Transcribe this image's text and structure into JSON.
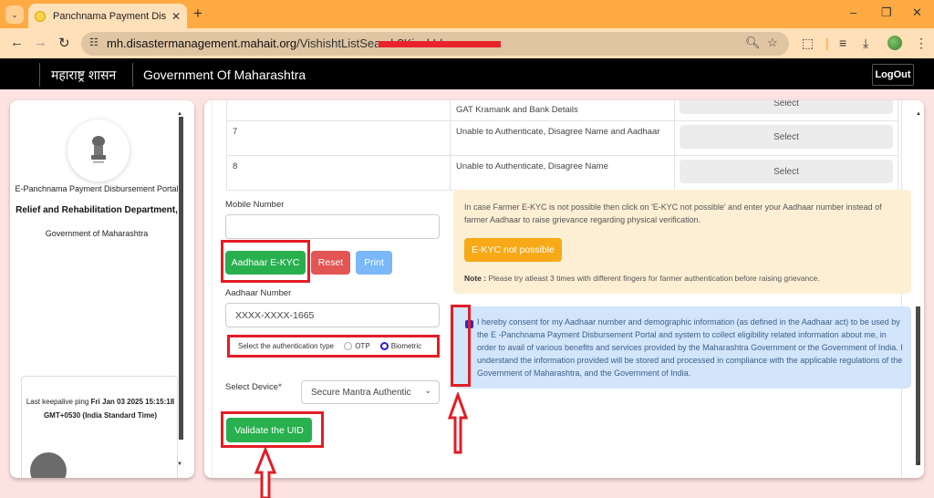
{
  "browser": {
    "tab_title": "Panchnama Payment Disbursement Portal",
    "tab_title_visible": "Panchnama Payment Disbursem",
    "url_domain": "mh.disastermanagement.mahait.org",
    "url_path": "/VishishtListSearch?KioskId=",
    "icons": {
      "tab_search": "chevron-down-icon",
      "close_tab": "close-icon",
      "new_tab": "plus-icon",
      "minimize": "minimize-icon",
      "restore": "restore-icon",
      "close_window": "close-icon",
      "back": "back-arrow-icon",
      "forward": "forward-arrow-icon",
      "reload": "reload-icon",
      "site_info": "tune-icon",
      "zoom": "zoom-icon",
      "bookmark": "star-icon",
      "extensions": "puzzle-icon",
      "media": "media-queue-icon",
      "downloads": "download-icon",
      "menu": "kebab-menu-icon"
    }
  },
  "header": {
    "marathi_title": "महाराष्ट्र शासन",
    "gov_title": "Government Of Maharashtra",
    "logout_label": "LogOut"
  },
  "sidebar": {
    "portal_name": "E-Panchnama Payment Disbursement Portal",
    "department": "Relief and Rehabilitation Department,",
    "government": "Government of Maharashtra",
    "ping_label": "Last keepalive ping",
    "ping_value": "Fri Jan 03 2025 15:15:18 GMT+0530 (India Standard Time)"
  },
  "table": {
    "rows": [
      {
        "num": "",
        "reason": "GAT Kramank and Bank Details",
        "action": "Select"
      },
      {
        "num": "7",
        "reason": "Unable to Authenticate, Disagree Name and Aadhaar",
        "action": "Select"
      },
      {
        "num": "8",
        "reason": "Unable to Authenticate, Disagree Name",
        "action": "Select"
      }
    ]
  },
  "form": {
    "mobile_label": "Mobile Number",
    "mobile_value": "",
    "aadhaar_ekyc_label": "Aadhaar E-KYC",
    "reset_label": "Reset",
    "print_label": "Print",
    "aadhaar_label": "Aadhaar Number",
    "aadhaar_value": "XXXX-XXXX-1665",
    "auth_type_label": "Select the authentication type",
    "auth_options": [
      "OTP",
      "Biometric"
    ],
    "auth_selected": "Biometric",
    "device_label": "Select Device*",
    "device_value": "Secure Mantra Authentic",
    "validate_label": "Validate the UID"
  },
  "warning": {
    "text": "In case Farmer E-KYC is not possible then click on 'E-KYC not possible' and enter your Aadhaar number instead of farmer Aadhaar to raise grievance regarding physical verification.",
    "button_label": "E-KYC not possible",
    "note_label": "Note :",
    "note_text": " Please try atleast 3 times with different fingers for farmer authentication before raising grievance."
  },
  "consent": {
    "checked": true,
    "text": "I hereby consent for my Aadhaar number and demographic information (as defined in the Aadhaar act) to be used by the E -Panchnama Payment Disbursement Portal and system to collect eligibility related information about me, in order to avail of various benefits and services provided by the Maharashtra Government or the Government of India. I understand the information provided will be stored and processed in compliance with the applicable regulations of the Government of Maharashtra, and the Government of India."
  },
  "colors": {
    "browser_frame": "#ffaa42",
    "success_green": "#28b04f",
    "danger_red": "#e35454",
    "print_blue": "#7ab8f7",
    "warning_orange": "#f7a917",
    "annotation_red": "#e21d26",
    "radio_selected": "#2a1fd3"
  }
}
